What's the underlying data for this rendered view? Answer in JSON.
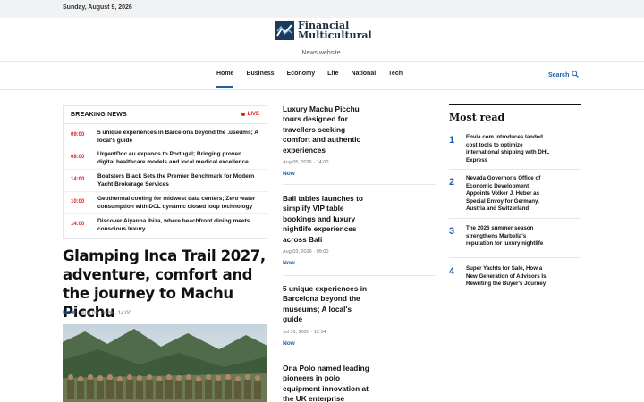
{
  "topbar": {
    "date": "Sunday, August 9, 2026"
  },
  "brand": {
    "line1": "Financial",
    "line2": "Multicultural",
    "tagline": "News website."
  },
  "nav": {
    "items": [
      {
        "label": "Home",
        "active": true
      },
      {
        "label": "Business",
        "active": false
      },
      {
        "label": "Economy",
        "active": false
      },
      {
        "label": "Life",
        "active": false
      },
      {
        "label": "National",
        "active": false
      },
      {
        "label": "Tech",
        "active": false
      }
    ],
    "search_label": "Search"
  },
  "breaking": {
    "title": "BREAKING NEWS",
    "live_label": "LIVE",
    "items": [
      {
        "time": "09:00",
        "text": "5 unique experiences in Barcelona beyond the .useums; A local's guide"
      },
      {
        "time": "08:00",
        "text": "UrgentDoc.eu expands to Portugal; Bringing proven digital healthcare models and local medical excellence"
      },
      {
        "time": "14:00",
        "text": "Boatsters Black Sets the Premier Benchmark for Modern Yacht Brokerage Services"
      },
      {
        "time": "10:00",
        "text": "Geothermal cooling for midwest data centers; Zero water consumption with DCL dynamic closed loop technology"
      },
      {
        "time": "14:00",
        "text": "Discover Aiyanna Ibiza, where beachfront dining meets conscious luxury"
      }
    ]
  },
  "feature": {
    "title": "Glamping Inca Trail 2027, adventure, comfort and the journey to Machu Picchu",
    "now": "Now",
    "date": "Aug 05, 2026 · 14:00"
  },
  "stories": [
    {
      "title": "Luxury Machu Picchu tours designed for travellers seeking comfort and authentic experiences",
      "date": "Aug 05, 2026 · 14:00",
      "now": "Now"
    },
    {
      "title": "Bali tables launches to simplify VIP table bookings and luxury nightlife experiences across Bali",
      "date": "Aug 03, 2026 · 09:00",
      "now": "Now"
    },
    {
      "title": "5 unique experiences in Barcelona beyond the museums; A local's guide",
      "date": "Jul 31, 2026 · 12:54",
      "now": "Now"
    },
    {
      "title": "Ona Polo named leading pioneers in polo equipment innovation at the UK enterprise",
      "date": "",
      "now": ""
    }
  ],
  "most_read": {
    "title": "Most read",
    "items": [
      {
        "num": "1",
        "text": "Envia.com introduces landed cost tools to optimize international shipping with DHL Express"
      },
      {
        "num": "2",
        "text": "Nevada Governor's Office of Economic Development Appoints Volker J. Huber as Special Envoy for Germany, Austria and Switzerland"
      },
      {
        "num": "3",
        "text": "The 2026 summer season strengthens Marbella's reputation for luxury nightlife"
      },
      {
        "num": "4",
        "text": "Super Yachts for Sale, How a New Generation of Advisors Is Rewriting the Buyer's Journey"
      }
    ]
  },
  "colors": {
    "accent": "#1b5fa8",
    "live": "#dd2222",
    "logo": "#1b3a5c"
  }
}
